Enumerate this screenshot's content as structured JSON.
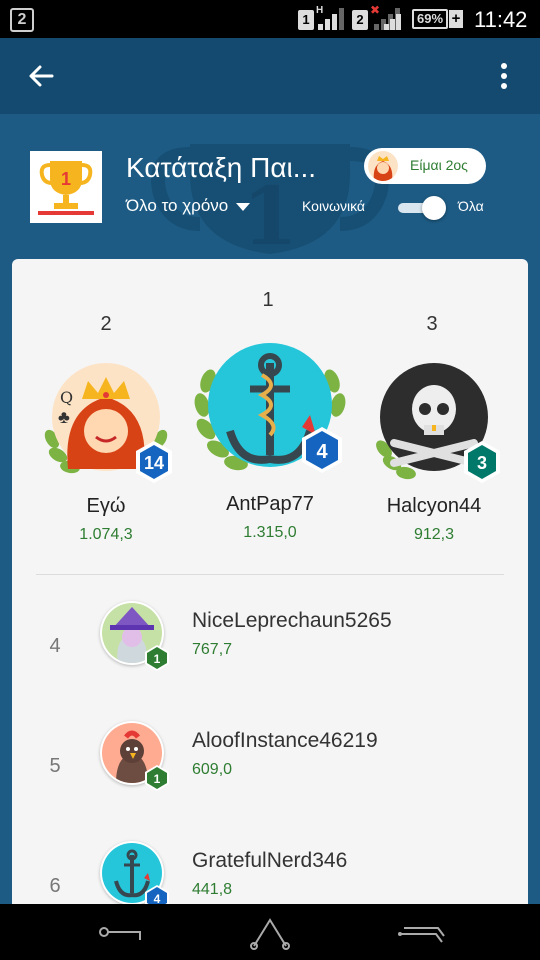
{
  "status_bar": {
    "left_badge": "2",
    "sim1": "1",
    "sim1_net": "H",
    "sim2": "2",
    "battery": "69%",
    "time": "11:42"
  },
  "app_bar": {
    "back_icon": "arrow-left-icon",
    "menu_icon": "more-vert-icon"
  },
  "header": {
    "title": "Κατάταξη Παι...",
    "trophy_rank": "1",
    "period_label": "Όλο το χρόνο",
    "rank_pill_label": "Είμαι 2ος",
    "filter_social": "Κοινωνικά",
    "filter_all": "Όλα",
    "toggle_on": true
  },
  "podium": {
    "first": {
      "position": "1",
      "name": "AntPap77",
      "score": "1.315,0",
      "level": "4"
    },
    "second": {
      "position": "2",
      "name": "Εγώ",
      "score": "1.074,3",
      "level": "14"
    },
    "third": {
      "position": "3",
      "name": "Halcyon44",
      "score": "912,3",
      "level": "3"
    }
  },
  "rows": [
    {
      "rank": "4",
      "name": "NiceLeprechaun5265",
      "score": "767,7",
      "level": "1"
    },
    {
      "rank": "5",
      "name": "AloofInstance46219",
      "score": "609,0",
      "level": "1"
    },
    {
      "rank": "6",
      "name": "GratefulNerd346",
      "score": "441,8",
      "level": "4"
    }
  ],
  "colors": {
    "primary_dark": "#154a70",
    "primary": "#1d5b84",
    "score_green": "#2e7d32",
    "level_blue": "#1565c0",
    "level_teal": "#00796b",
    "level_green": "#2e7d32"
  },
  "nav_icons": [
    "back-nav-icon",
    "home-nav-icon",
    "recents-nav-icon"
  ]
}
